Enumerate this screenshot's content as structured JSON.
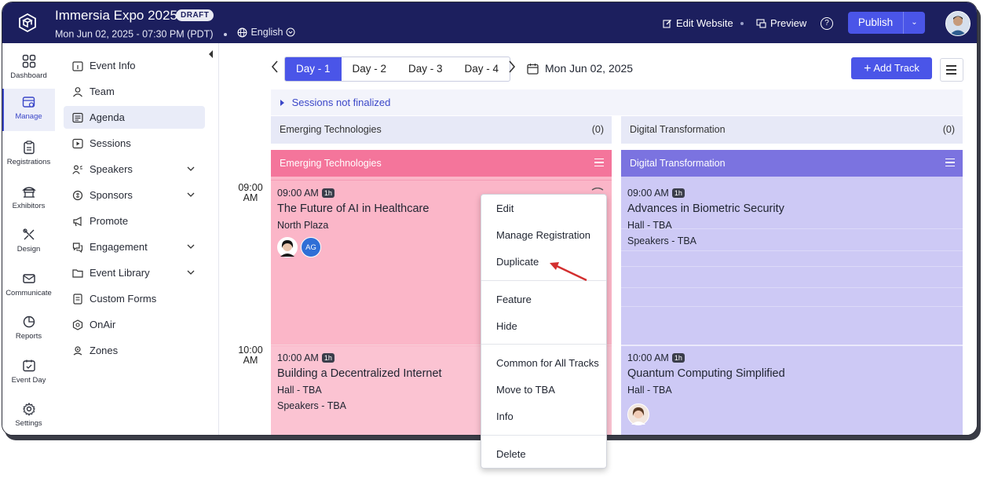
{
  "header": {
    "event_title": "Immersia Expo 2025",
    "status_badge": "DRAFT",
    "date_time": "Mon Jun 02, 2025 - 07:30 PM (PDT)",
    "language": "English",
    "edit_website": "Edit Website",
    "preview": "Preview",
    "help": "?",
    "publish": "Publish"
  },
  "rail": [
    {
      "label": "Dashboard",
      "icon": "grid-icon"
    },
    {
      "label": "Manage",
      "icon": "calendar-gear-icon",
      "active": true
    },
    {
      "label": "Registrations",
      "icon": "clipboard-icon"
    },
    {
      "label": "Exhibitors",
      "icon": "booth-icon"
    },
    {
      "label": "Design",
      "icon": "design-tools-icon"
    },
    {
      "label": "Communicate",
      "icon": "mail-icon"
    },
    {
      "label": "Reports",
      "icon": "pie-chart-icon"
    },
    {
      "label": "Event Day",
      "icon": "calendar-check-icon"
    },
    {
      "label": "Settings",
      "icon": "gear-icon"
    }
  ],
  "subnav": [
    {
      "label": "Event Info",
      "icon": "info-calendar-icon",
      "expand": false
    },
    {
      "label": "Team",
      "icon": "user-icon",
      "expand": false
    },
    {
      "label": "Agenda",
      "icon": "agenda-icon",
      "expand": false,
      "active": true
    },
    {
      "label": "Sessions",
      "icon": "play-icon",
      "expand": false
    },
    {
      "label": "Speakers",
      "icon": "speakers-icon",
      "expand": true
    },
    {
      "label": "Sponsors",
      "icon": "sponsors-icon",
      "expand": true
    },
    {
      "label": "Promote",
      "icon": "megaphone-icon",
      "expand": false
    },
    {
      "label": "Engagement",
      "icon": "engagement-icon",
      "expand": true
    },
    {
      "label": "Event Library",
      "icon": "library-icon",
      "expand": true
    },
    {
      "label": "Custom Forms",
      "icon": "form-icon",
      "expand": false
    },
    {
      "label": "OnAir",
      "icon": "onair-icon",
      "expand": false
    },
    {
      "label": "Zones",
      "icon": "zones-icon",
      "expand": false
    }
  ],
  "agenda": {
    "days": [
      "Day - 1",
      "Day - 2",
      "Day - 3",
      "Day - 4"
    ],
    "active_day": 0,
    "date": "Mon Jun 02, 2025",
    "add_track": "Add Track",
    "sessions_not_finalized": "Sessions not finalized",
    "unfinalized_tracks": [
      {
        "name": "Emerging Technologies",
        "count": "(0)"
      },
      {
        "name": "Digital Transformation",
        "count": "(0)"
      }
    ],
    "time_labels": [
      {
        "hour": "09:00",
        "ampm": "AM"
      },
      {
        "hour": "10:00",
        "ampm": "AM"
      }
    ],
    "tracks": [
      {
        "name": "Emerging Technologies",
        "head_color": "#f4759b",
        "body_color": "#fbb6c8",
        "sessions": [
          {
            "time": "09:00 AM",
            "duration": "1h",
            "title": "The Future of AI in Healthcare",
            "location": "North Plaza",
            "speakers_text": "",
            "avatars": [
              "photo",
              "AG"
            ]
          },
          {
            "time": "10:00 AM",
            "duration": "1h",
            "title": "Building a Decentralized Internet",
            "location": "Hall - TBA",
            "speakers_text": "Speakers - TBA",
            "avatars": []
          }
        ]
      },
      {
        "name": "Digital Transformation",
        "head_color": "#7b73e0",
        "body_color": "#cdc9f5",
        "sessions": [
          {
            "time": "09:00 AM",
            "duration": "1h",
            "title": "Advances in Biometric Security",
            "location": "Hall - TBA",
            "speakers_text": "Speakers - TBA",
            "avatars": []
          },
          {
            "time": "10:00 AM",
            "duration": "1h",
            "title": "Quantum Computing Simplified",
            "location": "Hall - TBA",
            "speakers_text": "",
            "avatars": [
              "photo"
            ]
          }
        ]
      }
    ]
  },
  "context_menu": {
    "items": [
      "Edit",
      "Manage Registration",
      "Duplicate",
      "Feature",
      "Hide",
      "Common for All Tracks",
      "Move to TBA",
      "Info",
      "Delete"
    ]
  },
  "colors": {
    "header_bg": "#1c1f5e",
    "accent": "#4a55e8",
    "annotation_arrow": "#d32f2f"
  }
}
